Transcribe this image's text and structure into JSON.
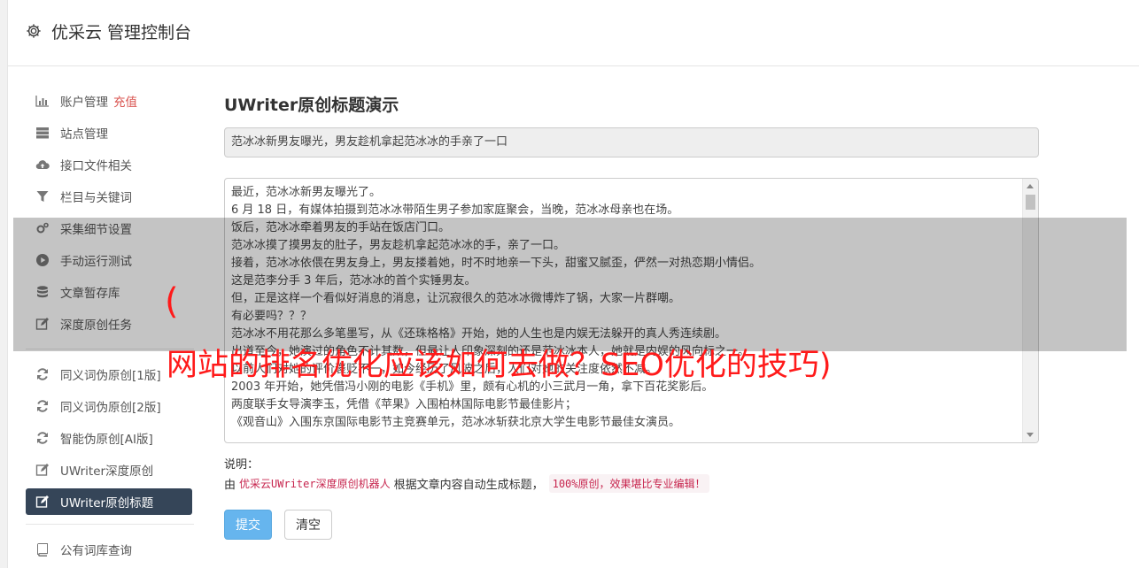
{
  "header": {
    "title": "优采云 管理控制台",
    "icon": "gear-icon"
  },
  "sidebar": {
    "items": [
      {
        "label": "账户管理",
        "extra": "充值",
        "icon": "bar-chart-icon"
      },
      {
        "label": "站点管理",
        "icon": "server-icon"
      },
      {
        "label": "接口文件相关",
        "icon": "cloud-upload-icon"
      },
      {
        "label": "栏目与关键词",
        "icon": "filter-icon"
      },
      {
        "label": "采集细节设置",
        "icon": "cogs-icon"
      },
      {
        "label": "手动运行测试",
        "icon": "play-circle-icon"
      },
      {
        "label": "文章暂存库",
        "icon": "database-icon"
      },
      {
        "label": "深度原创任务",
        "icon": "edit-icon"
      },
      {
        "label": "同义词伪原创[1版]",
        "icon": "refresh-icon"
      },
      {
        "label": "同义词伪原创[2版]",
        "icon": "refresh-icon"
      },
      {
        "label": "智能伪原创[AI版]",
        "icon": "refresh-icon"
      },
      {
        "label": "UWriter深度原创",
        "icon": "edit-icon"
      },
      {
        "label": "UWriter原创标题",
        "icon": "edit-icon",
        "active": true
      },
      {
        "label": "公有词库查询",
        "icon": "book-icon"
      }
    ]
  },
  "main": {
    "title": "UWriter原创标题演示",
    "title_value": "范冰冰新男友曝光，男友趁机拿起范冰冰的手亲了一口",
    "content_lines": [
      "最近，范冰冰新男友曝光了。",
      "6 月 18 日，有媒体拍摄到范冰冰带陌生男子参加家庭聚会，当晚，范冰冰母亲也在场。",
      "饭后，范冰冰牵着男友的手站在饭店门口。",
      "范冰冰摸了摸男友的肚子，男友趁机拿起范冰冰的手，亲了一口。",
      "接着，范冰冰依偎在男友身上，男友搂着她，时不时地亲一下头，甜蜜又腻歪，俨然一对热恋期小情侣。",
      "这是范李分手 3 年后，范冰冰的首个实锤男友。",
      "但，正是这样一个看似好消息的消息，让沉寂很久的范冰冰微博炸了锅，大家一片群嘲。",
      "有必要吗？？？",
      "范冰冰不用花那么多笔墨写，从《还珠格格》开始，她的人生也是内娱无法躲开的真人秀连续剧。",
      "出道至今，她演过的角色不计其数，但最让人印象深刻的还是范冰冰本人，她就是内娱的风向标之一。",
      "以前人们对她的评价褒贬不一，如今经历了风波之后，人们对她的关注度依然不减。",
      "2003 年开始，她凭借冯小刚的电影《手机》里，颇有心机的小三武月一角，拿下百花奖影后。",
      "两度联手女导演李玉，凭借《苹果》入围柏林国际电影节最佳影片；",
      "《观音山》入围东京国际电影节主竞赛单元，范冰冰斩获北京大学生电影节最佳女演员。"
    ],
    "note_label": "说明：",
    "note_prefix": "由",
    "note_link": "优采云UWriter深度原创机器人",
    "note_middle": "根据文章内容自动生成标题，",
    "note_pill": "100%原创，效果堪比专业编辑！",
    "submit_label": "提交",
    "clear_label": "清空"
  },
  "overlay": {
    "paren": "(",
    "text": "网站的排名优化应该如何去做？SEO优化的技巧)"
  },
  "colors": {
    "accent": "#354558",
    "danger": "#d9534f",
    "overlay_text": "#ff1a1a",
    "submit": "#66b5ee"
  }
}
